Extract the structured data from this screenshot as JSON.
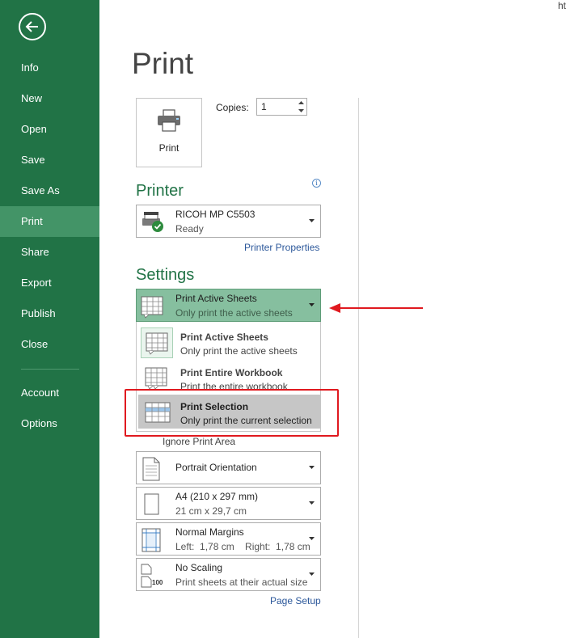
{
  "corner_text": "ht",
  "sidebar": {
    "items": [
      {
        "label": "Info"
      },
      {
        "label": "New"
      },
      {
        "label": "Open"
      },
      {
        "label": "Save"
      },
      {
        "label": "Save As"
      },
      {
        "label": "Print"
      },
      {
        "label": "Share"
      },
      {
        "label": "Export"
      },
      {
        "label": "Publish"
      },
      {
        "label": "Close"
      },
      {
        "label": "Account"
      },
      {
        "label": "Options"
      }
    ],
    "active": "Print"
  },
  "main": {
    "title": "Print",
    "print_button": "Print",
    "copies_label": "Copies:",
    "copies_value": "1",
    "printer": {
      "heading": "Printer",
      "name": "RICOH MP C5503",
      "status": "Ready",
      "properties_link": "Printer Properties"
    },
    "settings": {
      "heading": "Settings",
      "scope": {
        "title": "Print Active Sheets",
        "desc": "Only print the active sheets"
      },
      "menu": [
        {
          "title": "Print Active Sheets",
          "desc": "Only print the active sheets"
        },
        {
          "title": "Print Entire Workbook",
          "desc": "Print the entire workbook"
        },
        {
          "title": "Print Selection",
          "desc": "Only print the current selection"
        }
      ],
      "ignore_print_area": "Ignore Print Area",
      "orientation": "Portrait Orientation",
      "paper": {
        "title": "A4 (210 x 297 mm)",
        "desc": "21 cm x 29,7 cm"
      },
      "margins": {
        "title": "Normal Margins",
        "desc": "Left:  1,78 cm    Right:  1,78 cm"
      },
      "scaling": {
        "title": "No Scaling",
        "desc": "Print sheets at their actual size",
        "icon_text": "100"
      },
      "page_setup_link": "Page Setup"
    }
  },
  "colors": {
    "sidebar_bg": "#217346",
    "sidebar_active": "#439467",
    "accent_green": "#217346",
    "selected_dropdown": "#86bf9f",
    "menu_hover": "#c6c6c6",
    "annotation_red": "#e0191f",
    "link_blue": "#2b579a"
  }
}
